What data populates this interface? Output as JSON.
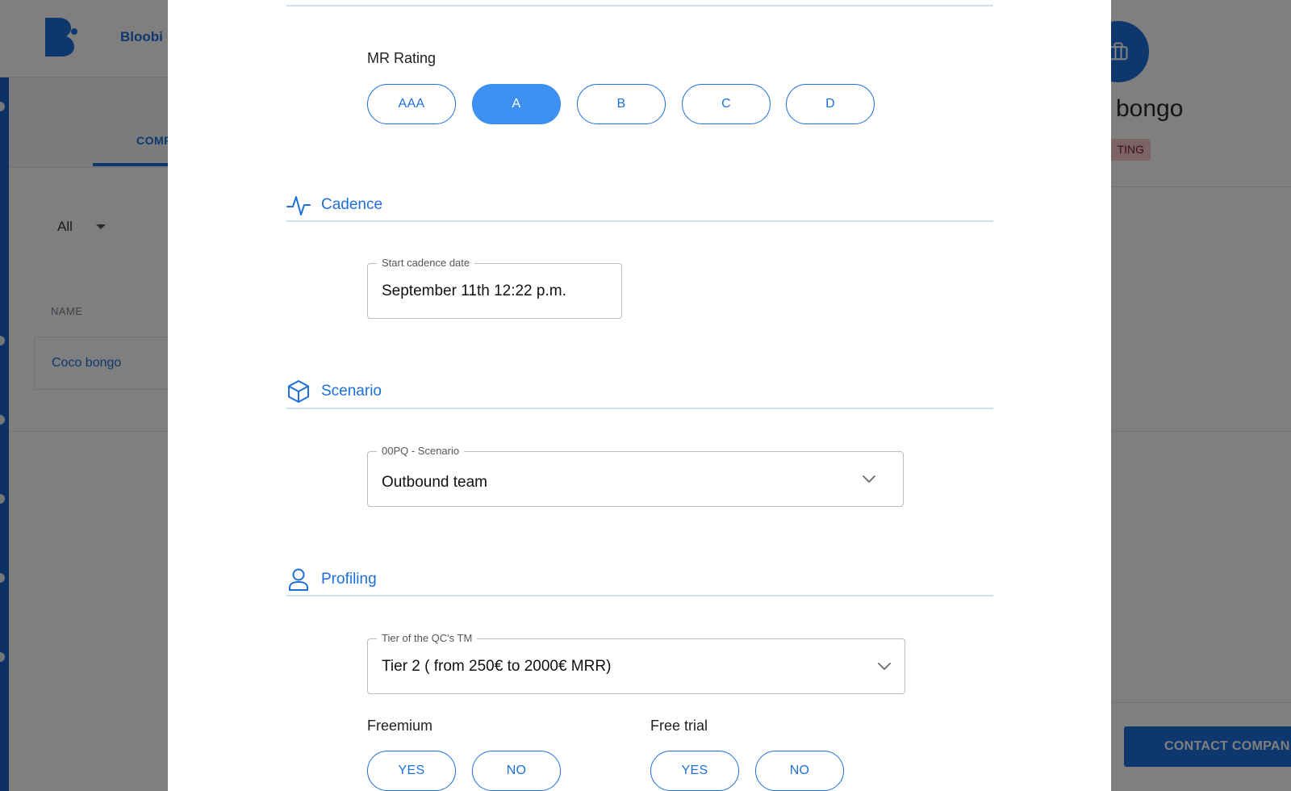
{
  "background": {
    "brand": "Bloobi",
    "tab_label": "COMPA",
    "filter_value": "All",
    "column_name": "NAME",
    "row_company": "Coco bongo",
    "company_title": "bongo",
    "status_badge": "TING",
    "contact_button": "CONTACT COMPAN"
  },
  "modal": {
    "mr_rating": {
      "label": "MR Rating",
      "options": [
        "AAA",
        "A",
        "B",
        "C",
        "D"
      ],
      "selected": "A"
    },
    "cadence": {
      "title": "Cadence",
      "icon": "activity-icon",
      "start_date_label": "Start cadence date",
      "start_date_value": "September 11th 12:22 p.m."
    },
    "scenario": {
      "title": "Scenario",
      "icon": "box-icon",
      "field_label": "00PQ - Scenario",
      "field_value": "Outbound team"
    },
    "profiling": {
      "title": "Profiling",
      "icon": "user-icon",
      "tier_label": "Tier of the QC's TM",
      "tier_value": "Tier 2 ( from 250€ to 2000€ MRR)",
      "freemium": {
        "label": "Freemium",
        "yes": "YES",
        "no": "NO"
      },
      "free_trial": {
        "label": "Free trial",
        "yes": "YES",
        "no": "NO"
      }
    }
  },
  "colors": {
    "accent": "#1d6fdc",
    "selected_pill": "#3d8ff0",
    "divider": "#cfe0f4",
    "overlay": "rgba(0,0,0,0.5)"
  }
}
